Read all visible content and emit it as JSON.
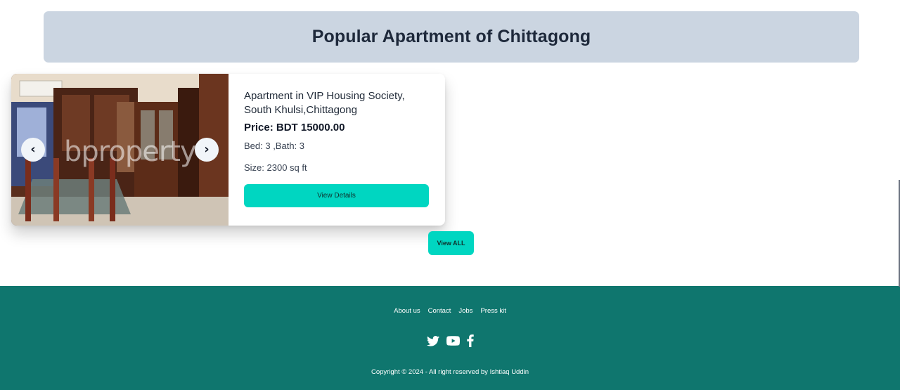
{
  "section": {
    "title": "Popular Apartment of Chittagong"
  },
  "listing": {
    "title": "Apartment in VIP Housing Society, South Khulsi,Chittagong",
    "price": "Price: BDT 15000.00",
    "beds_baths": "Bed: 3 ,Bath: 3",
    "size": "Size: 2300 sq ft",
    "details_button": "View Details",
    "image_watermark": "bproperty",
    "prev_label": "‹",
    "next_label": "›"
  },
  "view_all_button": "View ALL",
  "footer": {
    "links": [
      "About us",
      "Contact",
      "Jobs",
      "Press kit"
    ],
    "socials": [
      "twitter-icon",
      "youtube-icon",
      "facebook-icon"
    ],
    "copyright": "Copyright © 2024 - All right reserved by Ishtiaq Uddin"
  },
  "colors": {
    "banner_bg": "#cbd5e1",
    "accent": "#00d6c1",
    "footer_bg": "#0f766e"
  }
}
